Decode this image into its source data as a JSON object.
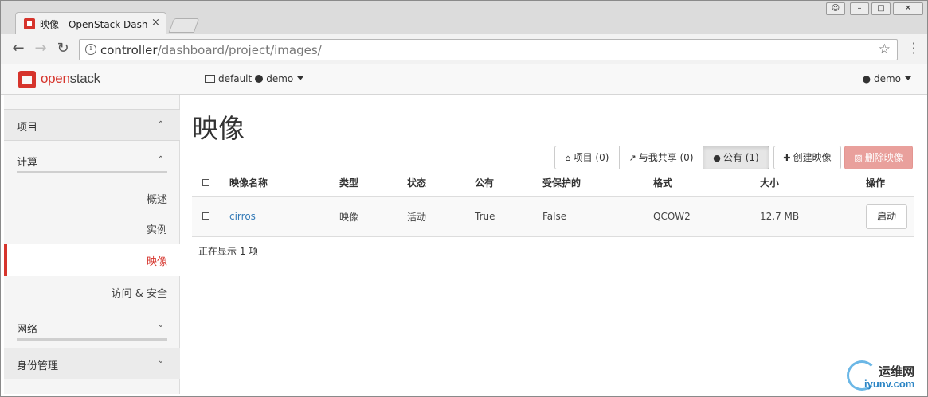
{
  "browser": {
    "tab_title": "映像 - OpenStack Dash",
    "tab_close": "×",
    "url_host": "controller",
    "url_path": "/dashboard/project/images/"
  },
  "header": {
    "logo_brand": "open",
    "logo_brand_strong": "stack",
    "domain": "default",
    "project": "demo",
    "user": "demo"
  },
  "sidebar": {
    "project_section": "项目",
    "compute_group": "计算",
    "items": [
      {
        "label": "概述"
      },
      {
        "label": "实例"
      },
      {
        "label": "映像"
      },
      {
        "label": "访问 & 安全"
      }
    ],
    "network_group": "网络",
    "identity_section": "身份管理"
  },
  "main": {
    "title": "映像",
    "filters": {
      "project": "项目 (0)",
      "shared": "与我共享 (0)",
      "public": "公有 (1)"
    },
    "create_button": "创建映像",
    "delete_button": "删除映像",
    "columns": [
      "映像名称",
      "类型",
      "状态",
      "公有",
      "受保护的",
      "格式",
      "大小",
      "操作"
    ],
    "rows": [
      {
        "name": "cirros",
        "type": "映像",
        "status": "活动",
        "public": "True",
        "protected": "False",
        "format": "QCOW2",
        "size": "12.7 MB",
        "action": "启动"
      }
    ],
    "summary": "正在显示 1 项"
  },
  "watermark": {
    "cn": "运维网",
    "en": "iyunv.com"
  },
  "colors": {
    "brand_red": "#d6342c",
    "link_blue": "#337ab7",
    "danger_button": "#e9a09c"
  }
}
